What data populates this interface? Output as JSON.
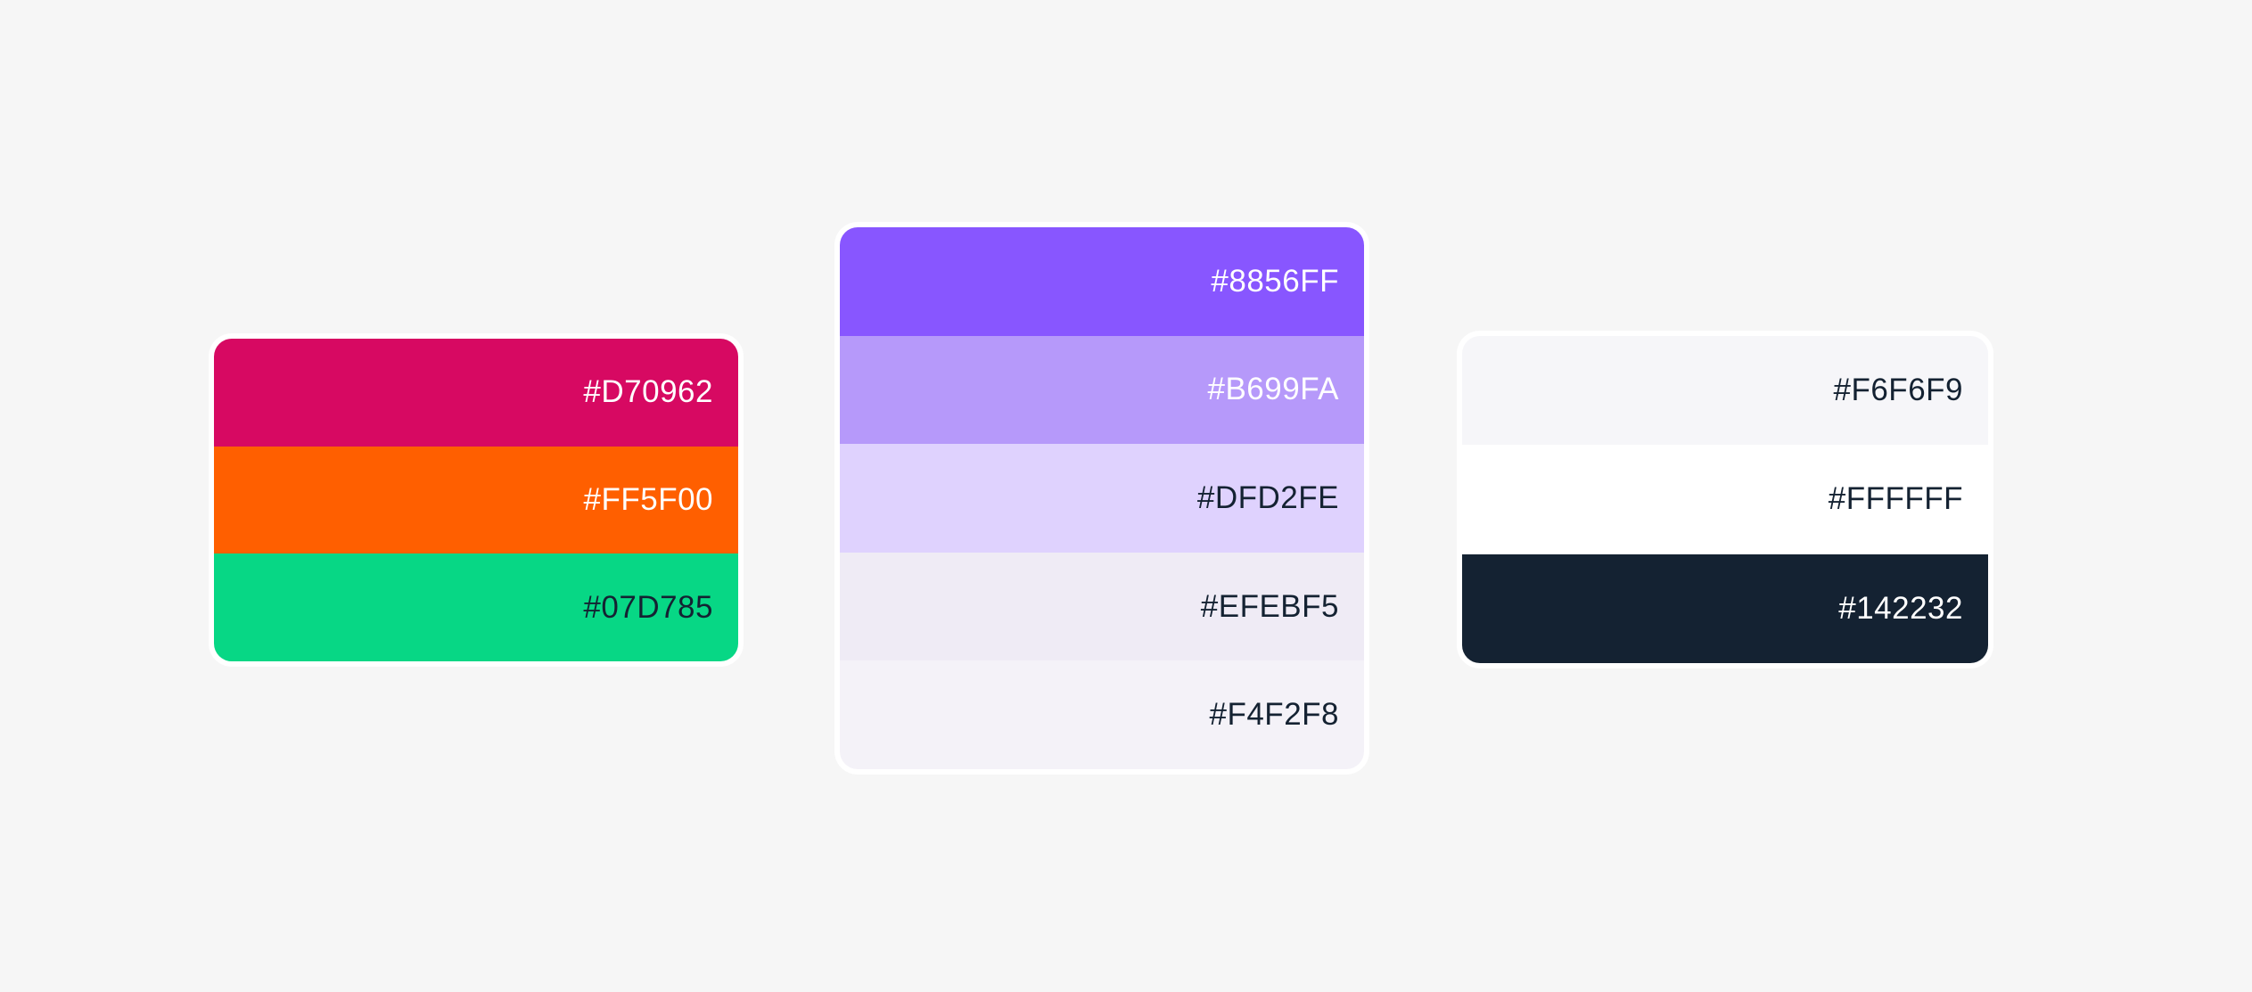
{
  "palettes": [
    {
      "id": "card-accent",
      "name": "accent-palette-card",
      "swatches": [
        {
          "hex": "#D70962",
          "label": "#D70962",
          "text_color": "#FFFFFF"
        },
        {
          "hex": "#FF5F00",
          "label": "#FF5F00",
          "text_color": "#FFFFFF"
        },
        {
          "hex": "#07D785",
          "label": "#07D785",
          "text_color": "#142232"
        }
      ]
    },
    {
      "id": "card-purple",
      "name": "purple-palette-card",
      "swatches": [
        {
          "hex": "#8856FF",
          "label": "#8856FF",
          "text_color": "#FFFFFF"
        },
        {
          "hex": "#B699FA",
          "label": "#B699FA",
          "text_color": "#FFFFFF"
        },
        {
          "hex": "#DFD2FE",
          "label": "#DFD2FE",
          "text_color": "#142232"
        },
        {
          "hex": "#EFEBF5",
          "label": "#EFEBF5",
          "text_color": "#142232"
        },
        {
          "hex": "#F4F2F8",
          "label": "#F4F2F8",
          "text_color": "#142232"
        }
      ]
    },
    {
      "id": "card-neutral",
      "name": "neutral-palette-card",
      "swatches": [
        {
          "hex": "#F6F6F9",
          "label": "#F6F6F9",
          "text_color": "#142232"
        },
        {
          "hex": "#FFFFFF",
          "label": "#FFFFFF",
          "text_color": "#142232"
        },
        {
          "hex": "#142232",
          "label": "#142232",
          "text_color": "#FFFFFF"
        }
      ]
    }
  ]
}
